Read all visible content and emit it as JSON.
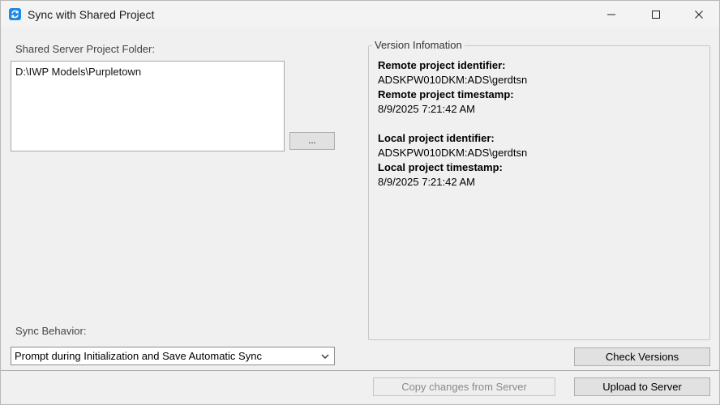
{
  "window": {
    "title": "Sync with Shared Project",
    "controls": {
      "minimize": "minimize",
      "maximize": "maximize",
      "close": "close"
    }
  },
  "folder": {
    "label": "Shared Server Project Folder:",
    "value": "D:\\IWP Models\\Purpletown",
    "browse_label": "..."
  },
  "version_info": {
    "title": "Version Infomation",
    "remote_id_label": "Remote project identifier:",
    "remote_id_value": "ADSKPW010DKM:ADS\\gerdtsn",
    "remote_ts_label": "Remote project timestamp:",
    "remote_ts_value": "8/9/2025 7:21:42 AM",
    "local_id_label": "Local project identifier:",
    "local_id_value": "ADSKPW010DKM:ADS\\gerdtsn",
    "local_ts_label": "Local project timestamp:",
    "local_ts_value": "8/9/2025 7:21:42 AM"
  },
  "sync": {
    "label": "Sync Behavior:",
    "selected": "Prompt during Initialization and Save Automatic Sync"
  },
  "buttons": {
    "check_versions": "Check Versions",
    "copy_changes": "Copy changes from Server",
    "upload": "Upload to Server"
  },
  "colors": {
    "accent": "#1e88e5",
    "background": "#f0f0f0",
    "disabled_text": "#8a8a8a"
  }
}
